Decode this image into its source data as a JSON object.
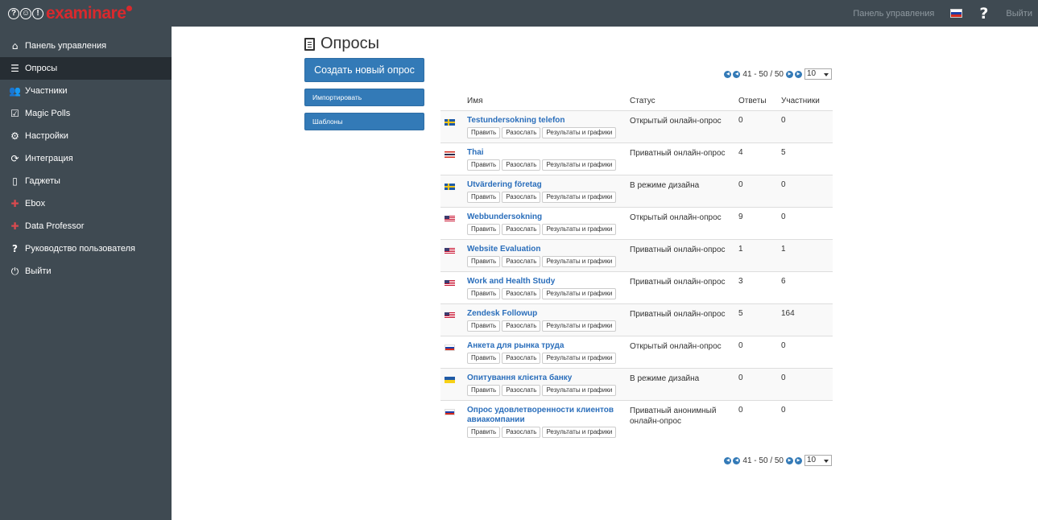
{
  "header": {
    "logo_word": "examinare",
    "logo_glyphs": [
      "?",
      "☺",
      "!"
    ],
    "dashboard_link": "Панель управления",
    "logout_link": "Выйти"
  },
  "sidebar": {
    "items": [
      {
        "label": "Панель управления",
        "icon": "home-icon"
      },
      {
        "label": "Опросы",
        "icon": "list-icon",
        "active": true
      },
      {
        "label": "Участники",
        "icon": "users-icon"
      },
      {
        "label": "Magic Polls",
        "icon": "checkbox-icon"
      },
      {
        "label": "Настройки",
        "icon": "gears-icon"
      },
      {
        "label": "Интеграция",
        "icon": "sync-icon"
      },
      {
        "label": "Гаджеты",
        "icon": "tablet-icon"
      },
      {
        "label": "Ebox",
        "icon": "gift-icon"
      },
      {
        "label": "Data Professor",
        "icon": "gift-icon"
      },
      {
        "label": "Руководство пользователя",
        "icon": "question-icon"
      },
      {
        "label": "Выйти",
        "icon": "power-icon"
      }
    ]
  },
  "main": {
    "title": "Опросы",
    "create_button": "Создать новый опрос",
    "import_button": "Импортировать",
    "templates_button": "Шаблоны",
    "pager": {
      "range": "41 - 50 / 50",
      "per_page": "10"
    },
    "table": {
      "headers": {
        "name": "Имя",
        "status": "Статус",
        "answers": "Ответы",
        "participants": "Участники"
      },
      "action_labels": {
        "edit": "Править",
        "send": "Разослать",
        "results": "Результаты и графики"
      },
      "rows": [
        {
          "flag": "se",
          "name": "Testundersokning telefon",
          "status": "Открытый онлайн-опрос",
          "answers": "0",
          "participants": "0",
          "ans_link": false,
          "part_link": false
        },
        {
          "flag": "th",
          "name": "Thai",
          "status": "Приватный онлайн-опрос",
          "answers": "4",
          "participants": "5",
          "ans_link": true,
          "part_link": true
        },
        {
          "flag": "se",
          "name": "Utvärdering företag",
          "status": "В режиме дизайна",
          "answers": "0",
          "participants": "0",
          "ans_link": false,
          "part_link": false
        },
        {
          "flag": "us",
          "name": "Webbundersokning",
          "status": "Открытый онлайн-опрос",
          "answers": "9",
          "participants": "0",
          "ans_link": true,
          "part_link": false
        },
        {
          "flag": "us",
          "name": "Website Evaluation",
          "status": "Приватный онлайн-опрос",
          "answers": "1",
          "participants": "1",
          "ans_link": true,
          "part_link": true
        },
        {
          "flag": "us",
          "name": "Work and Health Study",
          "status": "Приватный онлайн-опрос",
          "answers": "3",
          "participants": "6",
          "ans_link": true,
          "part_link": true
        },
        {
          "flag": "us",
          "name": "Zendesk Followup",
          "status": "Приватный онлайн-опрос",
          "answers": "5",
          "participants": "164",
          "ans_link": true,
          "part_link": true
        },
        {
          "flag": "ru",
          "name": "Анкета для рынка труда",
          "status": "Открытый онлайн-опрос",
          "answers": "0",
          "participants": "0",
          "ans_link": false,
          "part_link": false
        },
        {
          "flag": "ua",
          "name": "Опитування клієнта банку",
          "status": "В режиме дизайна",
          "answers": "0",
          "participants": "0",
          "ans_link": false,
          "part_link": false
        },
        {
          "flag": "ru",
          "name": "Опрос удовлетворенности клиентов авиакомпании",
          "status": "Приватный анонимный онлайн-опрос",
          "answers": "0",
          "participants": "0",
          "ans_link": false,
          "part_link": false
        }
      ]
    }
  }
}
